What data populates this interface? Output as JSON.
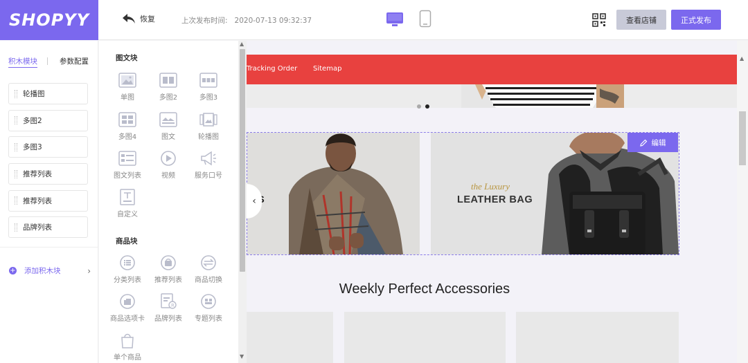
{
  "app": {
    "logo_text": "SHOPYY",
    "undo_label": "恢复",
    "last_publish_label": "上次发布时间:",
    "last_publish_time": "2020-07-13 09:32:37",
    "view_store_label": "查看店铺",
    "publish_label": "正式发布",
    "accent_color": "#7b68ee"
  },
  "left_panel": {
    "tabs": [
      "积木模块",
      "参数配置"
    ],
    "active_tab": "积木模块",
    "blocks": [
      "轮播图",
      "多图2",
      "多图3",
      "推荐列表",
      "推荐列表",
      "品牌列表"
    ],
    "add_block_label": "添加积木块"
  },
  "component_panel": {
    "section1_title": "图文块",
    "section1_items": [
      "单图",
      "多图2",
      "多图3",
      "多图4",
      "图文",
      "轮播图",
      "图文列表",
      "视频",
      "服务口号",
      "自定义"
    ],
    "section2_title": "商品块",
    "section2_items": [
      "分类列表",
      "推荐列表",
      "商品切换",
      "商品选项卡",
      "品牌列表",
      "专题列表",
      "单个商品"
    ]
  },
  "preview": {
    "nav_links": [
      "Tracking Order",
      "Sitemap"
    ],
    "nav_color": "#e8413f",
    "banner1_text": "ES",
    "banner2_script": "the Luxury",
    "banner2_title": "LEATHER BAG",
    "edit_label": "编辑",
    "section_heading": "Weekly Perfect Accessories"
  }
}
